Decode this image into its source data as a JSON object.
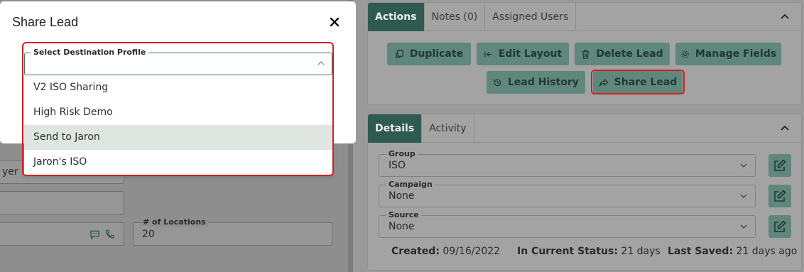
{
  "modal": {
    "title": "Share Lead",
    "close_icon": "close-icon",
    "select": {
      "label": "Select Destination Profile",
      "value": "",
      "options": [
        "V2 ISO Sharing",
        "High Risk Demo",
        "Send to Jaron",
        "Jaron's ISO"
      ],
      "hovered_index": 2
    }
  },
  "background_form": {
    "field_partial_value": "yer",
    "locations_label": "# of Locations",
    "locations_value": "20"
  },
  "actions_panel": {
    "tabs": [
      "Actions",
      "Notes (0)",
      "Assigned Users"
    ],
    "active_tab": "Actions",
    "buttons": {
      "duplicate": "Duplicate",
      "edit_layout": "Edit Layout",
      "delete_lead": "Delete Lead",
      "manage_fields": "Manage Fields",
      "lead_history": "Lead History",
      "share_lead": "Share Lead"
    }
  },
  "details_panel": {
    "tabs": [
      "Details",
      "Activity"
    ],
    "active_tab": "Details",
    "fields": {
      "group": {
        "label": "Group",
        "value": "ISO"
      },
      "campaign": {
        "label": "Campaign",
        "value": "None"
      },
      "source": {
        "label": "Source",
        "value": "None"
      }
    },
    "meta": {
      "created_label": "Created:",
      "created_value": "09/16/2022",
      "status_label": "In Current Status:",
      "status_value": "21 days",
      "saved_label": "Last Saved:",
      "saved_value": "21 days ago"
    }
  },
  "colors": {
    "accent": "#2f5a4f",
    "highlight": "#d0201f",
    "overlay": "#8e8e8e"
  }
}
